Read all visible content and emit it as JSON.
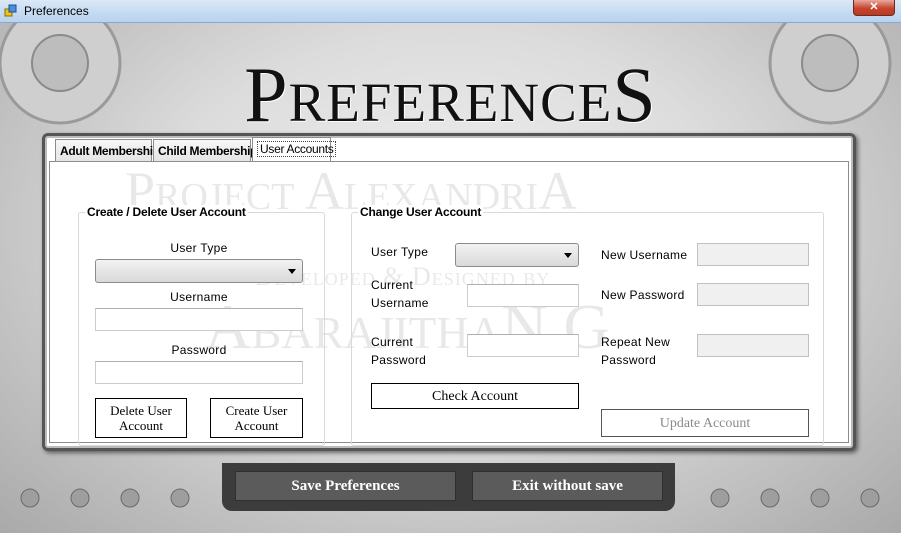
{
  "window": {
    "title": "Preferences",
    "close_glyph": "✕"
  },
  "header": {
    "title": "PreferenceS"
  },
  "tabs": [
    {
      "label": "Adult Membership"
    },
    {
      "label": "Child Membership"
    },
    {
      "label": "User Accounts",
      "active": true
    }
  ],
  "watermark": {
    "line1": "Project AlexandriA",
    "line2": "Developed & Designed by",
    "line3": "AbarajithaN.G"
  },
  "create_delete": {
    "group_title": "Create / Delete User Account",
    "user_type_label": "User Type",
    "user_type_value": "",
    "username_label": "Username",
    "username_value": "",
    "password_label": "Password",
    "password_value": "",
    "delete_button": "Delete User Account",
    "create_button": "Create User Account"
  },
  "change_account": {
    "group_title": "Change User Account",
    "user_type_label": "User Type",
    "user_type_value": "",
    "current_username_label": "Current Username",
    "current_username_value": "",
    "current_password_label": "Current Password",
    "current_password_value": "",
    "check_button": "Check Account",
    "new_username_label": "New Username",
    "new_username_value": "",
    "new_password_label": "New Password",
    "new_password_value": "",
    "repeat_password_label": "Repeat New Password",
    "repeat_password_value": "",
    "update_button": "Update Account",
    "update_disabled": true
  },
  "footer": {
    "save_button": "Save Preferences",
    "exit_button": "Exit without save"
  },
  "colors": {
    "titlebar": "#c4daf2",
    "close_button": "#c7452e",
    "footer_button": "#5b5b5b"
  }
}
